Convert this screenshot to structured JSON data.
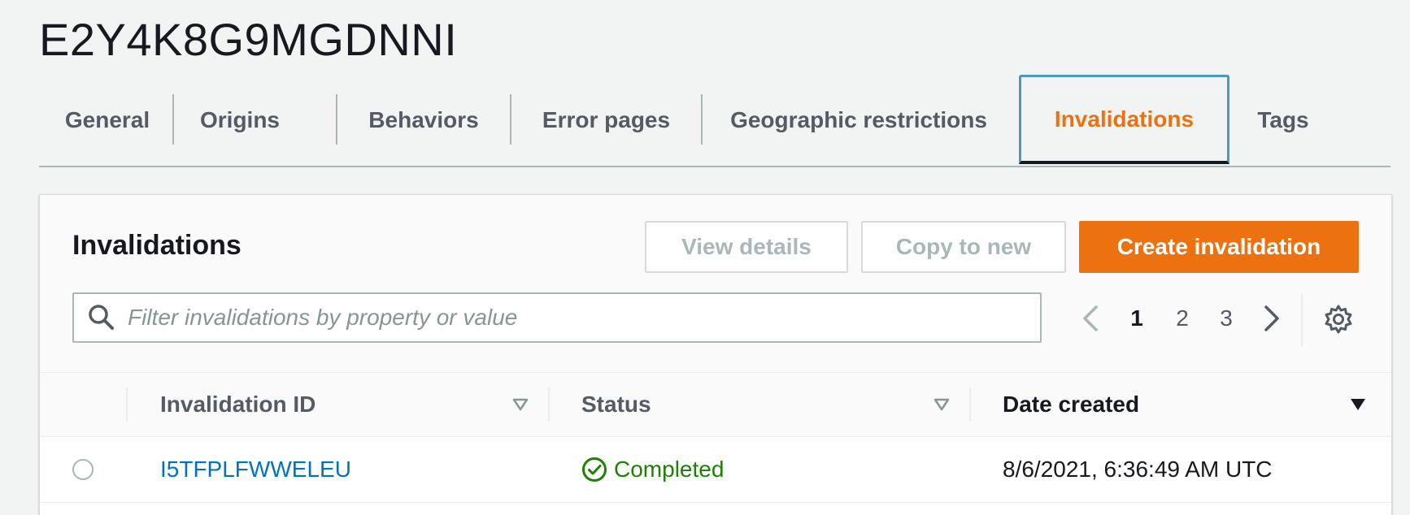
{
  "distribution": {
    "id": "E2Y4K8G9MGDNNI"
  },
  "tabs": [
    {
      "label": "General"
    },
    {
      "label": "Origins"
    },
    {
      "label": "Behaviors"
    },
    {
      "label": "Error pages"
    },
    {
      "label": "Geographic restrictions"
    },
    {
      "label": "Invalidations",
      "active": true
    },
    {
      "label": "Tags"
    }
  ],
  "panel": {
    "title": "Invalidations",
    "buttons": {
      "view_details": "View details",
      "copy_to_new": "Copy to new",
      "create": "Create invalidation"
    },
    "search": {
      "placeholder": "Filter invalidations by property or value",
      "value": ""
    },
    "pagination": {
      "pages": [
        "1",
        "2",
        "3"
      ],
      "current": "1"
    }
  },
  "table": {
    "columns": [
      "Invalidation ID",
      "Status",
      "Date created"
    ],
    "rows": [
      {
        "id": "I5TFPLFWWELEU",
        "status": "Completed",
        "date_created": "8/6/2021, 6:36:49 AM UTC"
      }
    ]
  },
  "colors": {
    "accent": "#ec7211",
    "link": "#0073bb",
    "success": "#1d8102",
    "active_tab_border": "#4b98c4"
  }
}
